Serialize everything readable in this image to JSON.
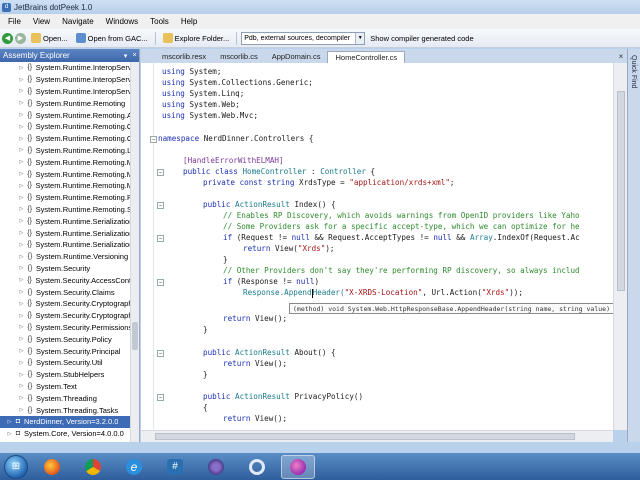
{
  "window": {
    "title": "JetBrains dotPeek 1.0"
  },
  "menu": [
    "File",
    "View",
    "Navigate",
    "Windows",
    "Tools",
    "Help"
  ],
  "toolbar": {
    "open_label": "Open...",
    "open_gac_label": "Open from GAC...",
    "explore_folder_label": "Explore Folder...",
    "source_combo_value": "Pdb, external sources, decompiler",
    "compiler_generated_label": "Show compiler generated code"
  },
  "explorer": {
    "title": "Assembly Explorer",
    "items": [
      {
        "label": "System.Runtime.InteropServ"
      },
      {
        "label": "System.Runtime.InteropServ"
      },
      {
        "label": "System.Runtime.InteropServ"
      },
      {
        "label": "System.Runtime.Remoting"
      },
      {
        "label": "System.Runtime.Remoting.A"
      },
      {
        "label": "System.Runtime.Remoting.C"
      },
      {
        "label": "System.Runtime.Remoting.C"
      },
      {
        "label": "System.Runtime.Remoting.L"
      },
      {
        "label": "System.Runtime.Remoting.M"
      },
      {
        "label": "System.Runtime.Remoting.M"
      },
      {
        "label": "System.Runtime.Remoting.M"
      },
      {
        "label": "System.Runtime.Remoting.P"
      },
      {
        "label": "System.Runtime.Remoting.S"
      },
      {
        "label": "System.Runtime.Serialization"
      },
      {
        "label": "System.Runtime.Serialization"
      },
      {
        "label": "System.Runtime.Serialization"
      },
      {
        "label": "System.Runtime.Versioning"
      },
      {
        "label": "System.Security"
      },
      {
        "label": "System.Security.AccessContr"
      },
      {
        "label": "System.Security.Claims"
      },
      {
        "label": "System.Security.Cryptograph"
      },
      {
        "label": "System.Security.Cryptograph"
      },
      {
        "label": "System.Security.Permissions"
      },
      {
        "label": "System.Security.Policy"
      },
      {
        "label": "System.Security.Principal"
      },
      {
        "label": "System.Security.Util"
      },
      {
        "label": "System.StubHelpers"
      },
      {
        "label": "System.Text"
      },
      {
        "label": "System.Threading"
      },
      {
        "label": "System.Threading.Tasks"
      }
    ],
    "root_items": [
      {
        "label": "NerdDinner, Version=3.2.0.0",
        "selected": true
      },
      {
        "label": "System.Core, Version=4.0.0.0",
        "selected": false
      }
    ]
  },
  "tabs": [
    {
      "label": "mscorlib.resx",
      "active": false
    },
    {
      "label": "mscorlib.cs",
      "active": false
    },
    {
      "label": "AppDomain.cs",
      "active": false
    },
    {
      "label": "HomeController.cs",
      "active": true
    }
  ],
  "code": {
    "using_kw": "using",
    "usings": [
      "System;",
      "System.Collections.Generic;",
      "System.Linq;",
      "System.Web;",
      "System.Web.Mvc;"
    ],
    "namespace_kw": "namespace",
    "namespace_name": "NerdDinner.Controllers",
    "attribute": "[HandleErrorWithELMAH]",
    "class_decl_kw": "public class",
    "class_name": "HomeController",
    "class_base_sep": " : ",
    "class_base": "Controller",
    "const_kw": "private const string",
    "const_name": " XrdsType = ",
    "const_value": "\"application/xrds+xml\"",
    "const_end": ";",
    "index_kw": "public",
    "index_type": "ActionResult",
    "index_sig": " Index() {",
    "comment1": "// Enables RP Discovery, which avoids warnings from OpenID providers like Yaho",
    "comment2": "// Some Providers ask for a specific accept-type, which we can optimize for he",
    "if1_kw": "if",
    "if1_a": " (Request != ",
    "null_kw": "null",
    "if1_b": " && Request.AcceptTypes != ",
    "if1_c": " && ",
    "array_type": "Array",
    "if1_d": ".IndexOf(Request.Ac",
    "return_kw": "return",
    "view_xrds_a": " View(",
    "view_xrds_str": "\"Xrds\"",
    "view_xrds_b": ");",
    "close_brace": "}",
    "open_brace": "{",
    "comment3": "// Other Providers don't say they're performing RP discovery, so always includ",
    "if2_a": " (Response != ",
    "if2_b": ")",
    "append_a": "Response.Append",
    "append_b": "Header(",
    "append_str1": "\"X-XRDS-Location\"",
    "append_c": ", Url.Action(",
    "append_str2": "\"Xrds\"",
    "append_d": "));",
    "tooltip": "(method) void System.Web.HttpResponseBase.AppendHeader(string name, string value)",
    "return_view": " View();",
    "about_sig": " About() {",
    "privacy_sig": " PrivacyPolicy()"
  },
  "quickfind": {
    "label": "Quick Find"
  },
  "colors": {
    "accent": "#3d6bb5",
    "keyword": "#1b2fb4",
    "type": "#1a7a8b",
    "string": "#a31515",
    "comment": "#2e8b2e"
  },
  "taskbar": {
    "icons": [
      "windows-start-icon",
      "firefox-icon",
      "chrome-icon",
      "internet-explorer-icon",
      "sharp-app-icon",
      "eye-app-icon",
      "loop-app-icon",
      "dotpeek-icon"
    ]
  }
}
